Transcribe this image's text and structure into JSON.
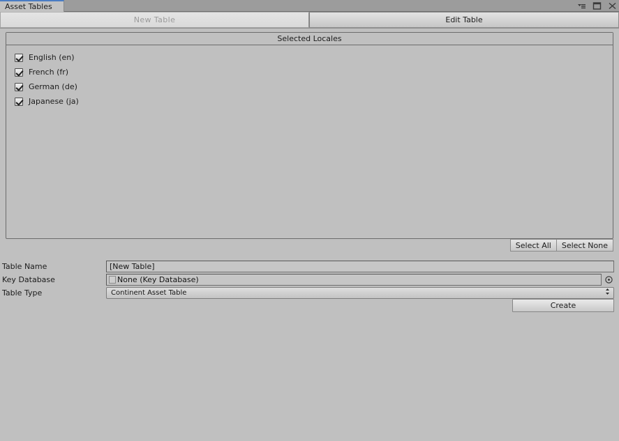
{
  "window": {
    "tab_title": "Asset Tables",
    "controls": [
      {
        "name": "menu-icon",
        "label": "▾≡"
      },
      {
        "name": "maximize-icon",
        "label": "❐"
      },
      {
        "name": "close-icon",
        "label": "✕"
      }
    ]
  },
  "tabs": [
    {
      "label": "New Table",
      "active": true
    },
    {
      "label": "Edit Table",
      "active": false
    }
  ],
  "locales_panel": {
    "header": "Selected Locales",
    "items": [
      {
        "label": "English (en)",
        "checked": true
      },
      {
        "label": "French (fr)",
        "checked": true
      },
      {
        "label": "German (de)",
        "checked": true
      },
      {
        "label": "Japanese (ja)",
        "checked": true
      }
    ],
    "select_all_label": "Select All",
    "select_none_label": "Select None"
  },
  "form": {
    "table_name": {
      "label": "Table Name",
      "value": "[New Table]",
      "placeholder": "Table Name"
    },
    "key_database": {
      "label": "Key Database",
      "value": "None (Key Database)",
      "picker_icon": "object-picker-icon"
    },
    "table_type": {
      "label": "Table Type",
      "value": "Continent Asset Table",
      "dropdown_icon": "updown-arrows-icon"
    }
  },
  "actions": {
    "create_label": "Create"
  },
  "colors": {
    "background": "#c0c0c0",
    "tab_accent": "#4a7dc4",
    "border": "#6c6c6c",
    "field_bg": "#c6c6c6"
  }
}
